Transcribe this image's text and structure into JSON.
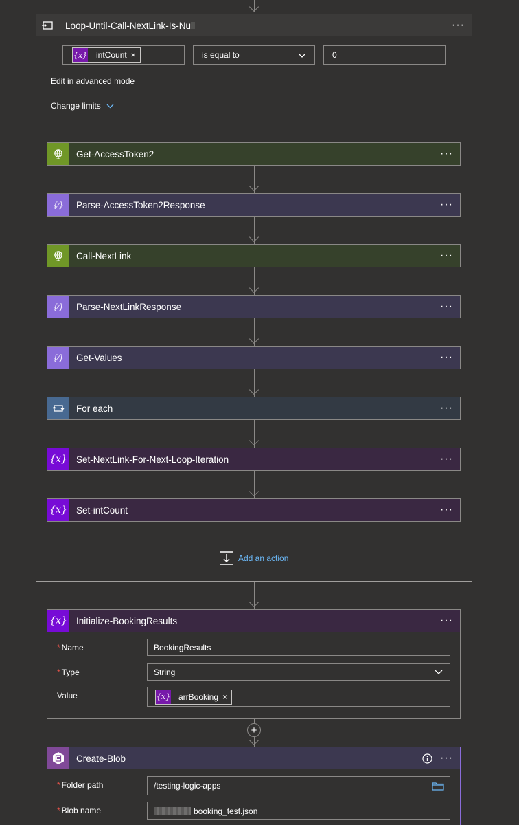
{
  "loop": {
    "title": "Loop-Until-Call-NextLink-Is-Null",
    "condition": {
      "token_icon": "{x}",
      "token_label": "intCount",
      "token_remove": "×",
      "operator": "is equal to",
      "value": "0"
    },
    "advanced_mode_link": "Edit in advanced mode",
    "change_limits_link": "Change limits",
    "add_action_label": "Add an action"
  },
  "actions": [
    {
      "label": "Get-AccessToken2",
      "kind": "http"
    },
    {
      "label": "Parse-AccessToken2Response",
      "kind": "parse"
    },
    {
      "label": "Call-NextLink",
      "kind": "http"
    },
    {
      "label": "Parse-NextLinkResponse",
      "kind": "parse"
    },
    {
      "label": "Get-Values",
      "kind": "parse"
    },
    {
      "label": "For each",
      "kind": "foreach"
    },
    {
      "label": "Set-NextLink-For-Next-Loop-Iteration",
      "kind": "variable"
    },
    {
      "label": "Set-intCount",
      "kind": "variable"
    }
  ],
  "more_glyph": "···",
  "var_glyph": "{x}",
  "init_card": {
    "title": "Initialize-BookingResults",
    "name_label": "Name",
    "name_value": "BookingResults",
    "type_label": "Type",
    "type_value": "String",
    "value_label": "Value",
    "value_token": "arrBooking",
    "required_mark": "*"
  },
  "blob_card": {
    "title": "Create-Blob",
    "folder_label": "Folder path",
    "folder_value": "/testing-logic-apps",
    "blob_label": "Blob name",
    "blob_value": "booking_test.json"
  },
  "insert_glyph": "+",
  "colors": {
    "background": "#323130",
    "http": "#709727",
    "parse": "#8a6cd9",
    "variable": "#770bd6",
    "foreach": "#486991",
    "link": "#6cb8f6"
  }
}
